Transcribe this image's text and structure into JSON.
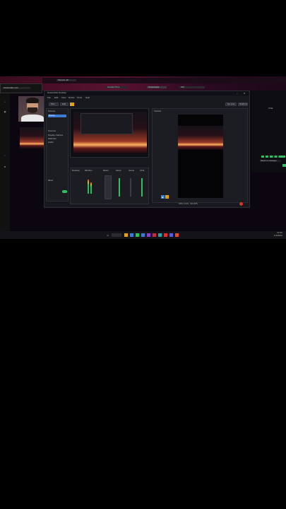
{
  "browser": {
    "tabs": [
      {
        "label": "Sample tab"
      },
      {
        "label": "Google Drive"
      },
      {
        "label": "Streamlabs"
      },
      {
        "label": "Tab"
      }
    ],
    "address": "streamlabs.com"
  },
  "left_sidebar": {
    "items": [
      "Home",
      "Scenes",
      "Sources",
      "Mixer",
      "Settings"
    ]
  },
  "studio": {
    "title": "Streamlabs Desktop",
    "menu": [
      "File",
      "Edit",
      "View",
      "Docks",
      "Tools",
      "Help"
    ],
    "buttons": {
      "test": "Test",
      "edit": "Edit",
      "go_live": "Go Live",
      "studio_mode": "Studio Mode"
    },
    "scenes_header": "Scenes",
    "scene_item": "Scene",
    "sources_header": "Sources",
    "sources": [
      "Display Capture",
      "Webcam",
      "Audio"
    ],
    "mixer_header": "Mixer",
    "channels": [
      "Desktop",
      "Mic/Aux",
      "Music",
      "Alerts",
      "Game",
      "Chat"
    ],
    "vertical_label": "Vertical",
    "status": "CPU 3.2% · 60 FPS"
  },
  "chat": {
    "header": "Chat",
    "input_placeholder": "Send a message"
  },
  "taskbar": {
    "time": "12:00",
    "date": "1/1/2024"
  },
  "colors": {
    "accent": "#3c7bd6",
    "live": "#30c060",
    "record": "#e03030"
  }
}
